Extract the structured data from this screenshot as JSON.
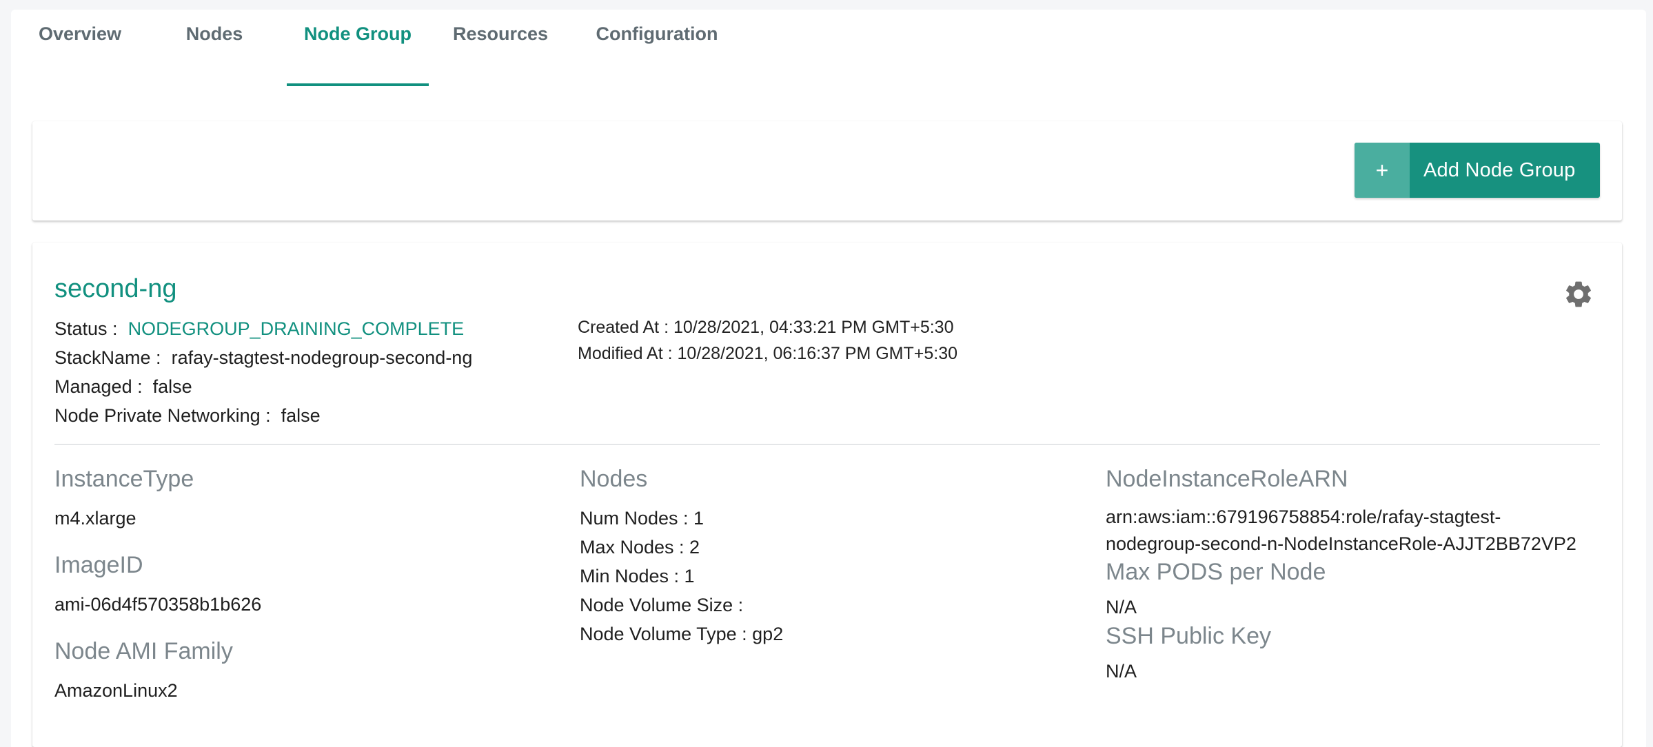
{
  "tabs": [
    {
      "label": "Overview"
    },
    {
      "label": "Nodes"
    },
    {
      "label": "Node Group"
    },
    {
      "label": "Resources"
    },
    {
      "label": "Configuration"
    }
  ],
  "active_tab": "Node Group",
  "toolbar": {
    "add_plus": "+",
    "add_label": "Add Node Group"
  },
  "nodegroup": {
    "name": "second-ng",
    "status_label": "Status :",
    "status_value": "NODEGROUP_DRAINING_COMPLETE",
    "stack_label": "StackName :",
    "stack_value": "rafay-stagtest-nodegroup-second-ng",
    "managed_label": "Managed :",
    "managed_value": "false",
    "private_label": "Node Private Networking :",
    "private_value": "false",
    "created": "Created At : 10/28/2021, 04:33:21 PM GMT+5:30",
    "modified": "Modified At : 10/28/2021, 06:16:37 PM GMT+5:30",
    "instance_type_title": "InstanceType",
    "instance_type": "m4.xlarge",
    "image_id_title": "ImageID",
    "image_id": "ami-06d4f570358b1b626",
    "ami_family_title": "Node AMI Family",
    "ami_family": "AmazonLinux2",
    "nodes_title": "Nodes",
    "num_nodes": "Num Nodes : 1",
    "max_nodes": "Max Nodes : 2",
    "min_nodes": "Min Nodes : 1",
    "volume_size": "Node Volume Size :",
    "volume_type": "Node Volume Type :  gp2",
    "role_arn_title": "NodeInstanceRoleARN",
    "role_arn_line1": "arn:aws:iam::679196758854:role/rafay-stagtest-",
    "role_arn_line2": "nodegroup-second-n-NodeInstanceRole-AJJT2BB72VP2",
    "max_pods_title": "Max PODS per Node",
    "max_pods": "N/A",
    "ssh_title": "SSH Public Key",
    "ssh": "N/A"
  },
  "colors": {
    "accent": "#11907f",
    "muted": "#7c868c"
  }
}
